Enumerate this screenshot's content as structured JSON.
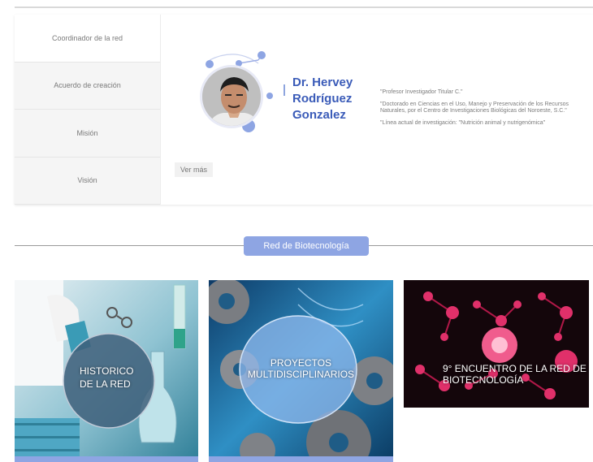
{
  "sidebar": {
    "items": [
      {
        "label": "Coordinador de la red"
      },
      {
        "label": "Acuerdo de creación"
      },
      {
        "label": "Misión"
      },
      {
        "label": "Visión"
      }
    ]
  },
  "profile": {
    "name_lines": [
      "Dr. Hervey",
      "Rodríguez",
      "Gonzalez"
    ],
    "bio": [
      "\"Profesor Investigador Titular C.\"",
      "\"Doctorado en Ciencias en el Uso, Manejo y Preservación de los Recursos Naturales, por el Centro de Investigaciones Biológicas del Noroeste, S.C.\"",
      "\"Línea actual de investigación: \"Nutrición animal y nutrigenómica\""
    ],
    "more_label": "Ver más"
  },
  "section": {
    "title": "Red de Biotecnología"
  },
  "tiles": [
    {
      "lines": [
        "HISTORICO",
        "DE LA RED"
      ]
    },
    {
      "lines": [
        "PROYECTOS",
        "MULTIDISCIPLINARIOS"
      ]
    },
    {
      "lines": [
        "9° ENCUENTRO DE LA RED DE",
        "BIOTECNOLOGÍA"
      ]
    }
  ],
  "colors": {
    "accent": "#8ea5e3",
    "name": "#3a5bb8",
    "tile3_bg": "#14060b"
  }
}
